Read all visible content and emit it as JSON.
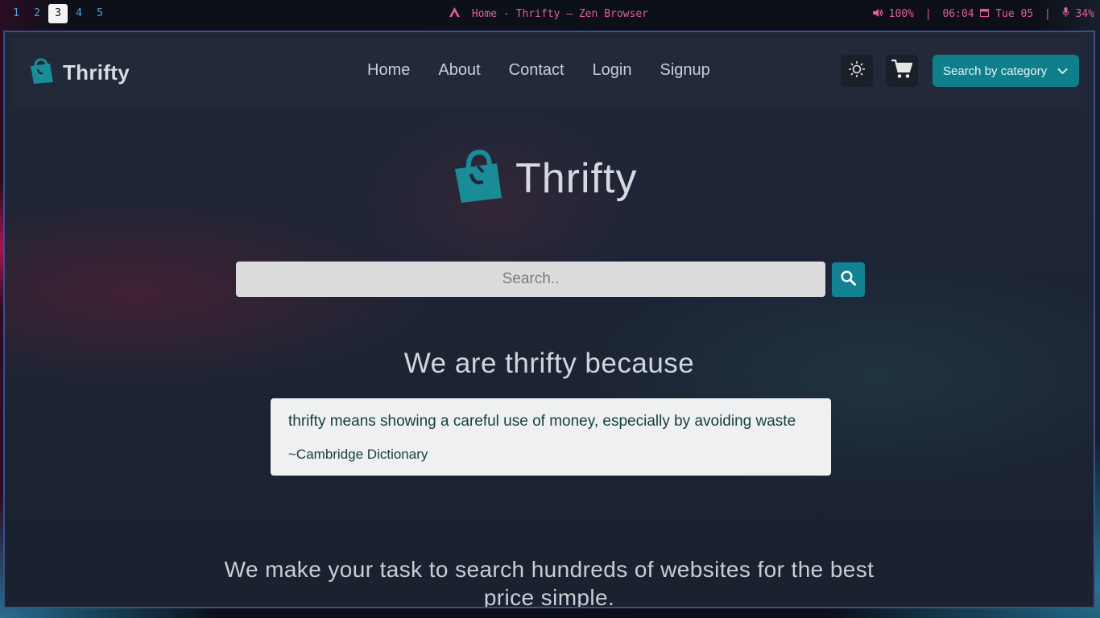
{
  "taskbar": {
    "workspaces": [
      {
        "label": "1",
        "active": false
      },
      {
        "label": "2",
        "active": false
      },
      {
        "label": "3",
        "active": true
      },
      {
        "label": "4",
        "active": false
      },
      {
        "label": "5",
        "active": false
      }
    ],
    "window_title": "Home - Thrifty — Zen Browser",
    "status": {
      "volume": "100%",
      "time": "06:04",
      "date": "Tue 05",
      "mic": "34%",
      "separator": "|"
    }
  },
  "navbar": {
    "brand": "Thrifty",
    "links": [
      "Home",
      "About",
      "Contact",
      "Login",
      "Signup"
    ],
    "category_button": "Search by category"
  },
  "hero": {
    "logo_text": "Thrifty",
    "search_placeholder": "Search..",
    "tagline": "We are thrifty because",
    "quote": {
      "text": "thrifty means showing a careful use of money, especially by avoiding waste",
      "source": "~Cambridge Dictionary"
    },
    "mission": "We make your task to search hundreds of websites for the best price simple."
  },
  "colors": {
    "accent": "#0f7f8c",
    "title_pink": "#e0609c",
    "workspace_blue": "#4da3d9"
  }
}
